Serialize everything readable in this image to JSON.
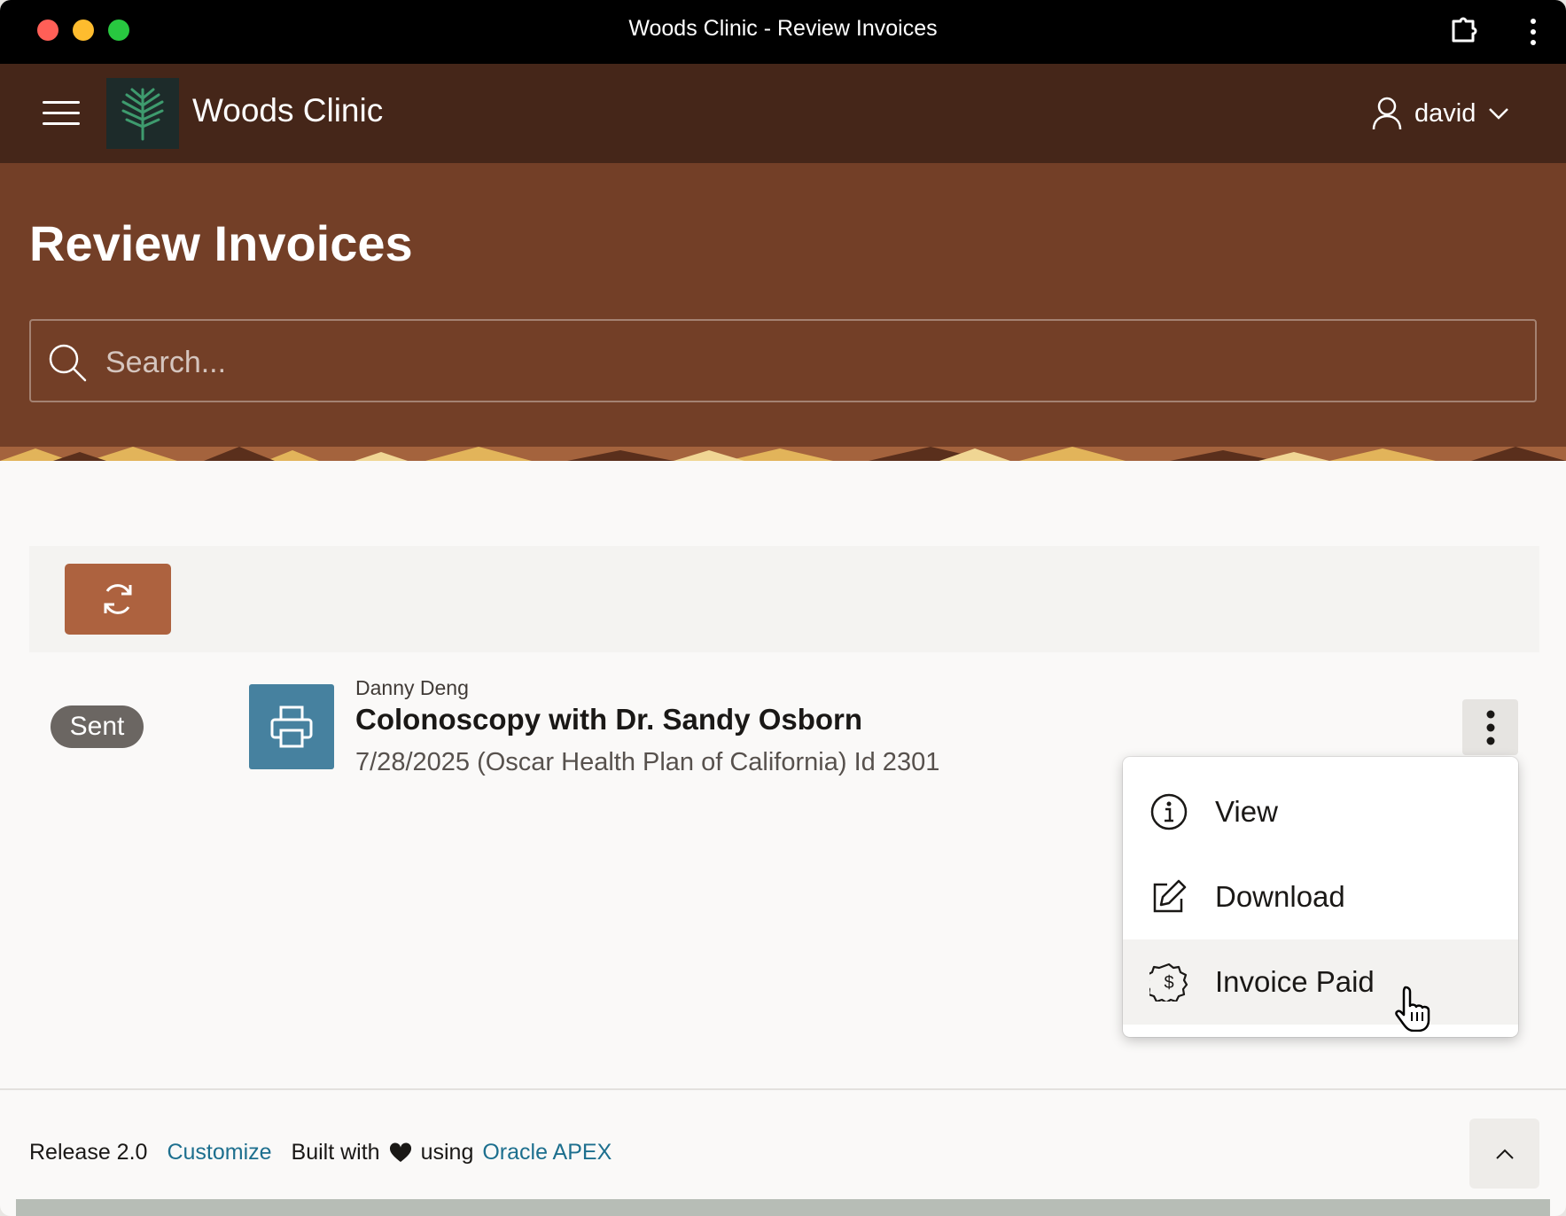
{
  "window": {
    "title": "Woods Clinic - Review Invoices"
  },
  "header": {
    "app_name": "Woods Clinic",
    "user_name": "david"
  },
  "hero": {
    "page_title": "Review Invoices",
    "search_placeholder": "Search..."
  },
  "row": {
    "status": "Sent",
    "patient": "Danny Deng",
    "title": "Colonoscopy with Dr. Sandy Osborn",
    "meta": "7/28/2025 (Oscar Health Plan of California) Id 2301"
  },
  "menu": {
    "items": [
      {
        "label": "View",
        "icon": "info-icon"
      },
      {
        "label": "Download",
        "icon": "edit-icon"
      },
      {
        "label": "Invoice Paid",
        "icon": "dollar-badge-icon",
        "hovered": true
      }
    ]
  },
  "footer": {
    "release": "Release 2.0",
    "customize": "Customize",
    "built_with": "Built with",
    "using": "using",
    "apex": "Oracle APEX"
  },
  "colors": {
    "titlebar": "#000000",
    "appbar": "#452619",
    "hero": "#733f27",
    "accent_button": "#ad623f",
    "print_tile": "#46819f",
    "status_badge": "#6b6662",
    "link": "#1d6f8e"
  }
}
